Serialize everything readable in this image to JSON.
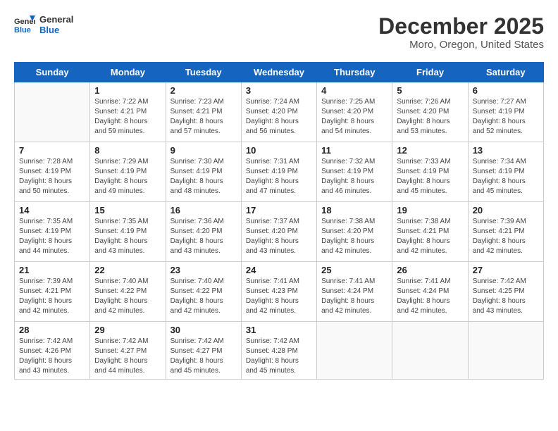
{
  "header": {
    "logo_line1": "General",
    "logo_line2": "Blue",
    "month": "December 2025",
    "location": "Moro, Oregon, United States"
  },
  "weekdays": [
    "Sunday",
    "Monday",
    "Tuesday",
    "Wednesday",
    "Thursday",
    "Friday",
    "Saturday"
  ],
  "weeks": [
    [
      {
        "day": "",
        "info": ""
      },
      {
        "day": "1",
        "info": "Sunrise: 7:22 AM\nSunset: 4:21 PM\nDaylight: 8 hours\nand 59 minutes."
      },
      {
        "day": "2",
        "info": "Sunrise: 7:23 AM\nSunset: 4:21 PM\nDaylight: 8 hours\nand 57 minutes."
      },
      {
        "day": "3",
        "info": "Sunrise: 7:24 AM\nSunset: 4:20 PM\nDaylight: 8 hours\nand 56 minutes."
      },
      {
        "day": "4",
        "info": "Sunrise: 7:25 AM\nSunset: 4:20 PM\nDaylight: 8 hours\nand 54 minutes."
      },
      {
        "day": "5",
        "info": "Sunrise: 7:26 AM\nSunset: 4:20 PM\nDaylight: 8 hours\nand 53 minutes."
      },
      {
        "day": "6",
        "info": "Sunrise: 7:27 AM\nSunset: 4:19 PM\nDaylight: 8 hours\nand 52 minutes."
      }
    ],
    [
      {
        "day": "7",
        "info": "Sunrise: 7:28 AM\nSunset: 4:19 PM\nDaylight: 8 hours\nand 50 minutes."
      },
      {
        "day": "8",
        "info": "Sunrise: 7:29 AM\nSunset: 4:19 PM\nDaylight: 8 hours\nand 49 minutes."
      },
      {
        "day": "9",
        "info": "Sunrise: 7:30 AM\nSunset: 4:19 PM\nDaylight: 8 hours\nand 48 minutes."
      },
      {
        "day": "10",
        "info": "Sunrise: 7:31 AM\nSunset: 4:19 PM\nDaylight: 8 hours\nand 47 minutes."
      },
      {
        "day": "11",
        "info": "Sunrise: 7:32 AM\nSunset: 4:19 PM\nDaylight: 8 hours\nand 46 minutes."
      },
      {
        "day": "12",
        "info": "Sunrise: 7:33 AM\nSunset: 4:19 PM\nDaylight: 8 hours\nand 45 minutes."
      },
      {
        "day": "13",
        "info": "Sunrise: 7:34 AM\nSunset: 4:19 PM\nDaylight: 8 hours\nand 45 minutes."
      }
    ],
    [
      {
        "day": "14",
        "info": "Sunrise: 7:35 AM\nSunset: 4:19 PM\nDaylight: 8 hours\nand 44 minutes."
      },
      {
        "day": "15",
        "info": "Sunrise: 7:35 AM\nSunset: 4:19 PM\nDaylight: 8 hours\nand 43 minutes."
      },
      {
        "day": "16",
        "info": "Sunrise: 7:36 AM\nSunset: 4:20 PM\nDaylight: 8 hours\nand 43 minutes."
      },
      {
        "day": "17",
        "info": "Sunrise: 7:37 AM\nSunset: 4:20 PM\nDaylight: 8 hours\nand 43 minutes."
      },
      {
        "day": "18",
        "info": "Sunrise: 7:38 AM\nSunset: 4:20 PM\nDaylight: 8 hours\nand 42 minutes."
      },
      {
        "day": "19",
        "info": "Sunrise: 7:38 AM\nSunset: 4:21 PM\nDaylight: 8 hours\nand 42 minutes."
      },
      {
        "day": "20",
        "info": "Sunrise: 7:39 AM\nSunset: 4:21 PM\nDaylight: 8 hours\nand 42 minutes."
      }
    ],
    [
      {
        "day": "21",
        "info": "Sunrise: 7:39 AM\nSunset: 4:21 PM\nDaylight: 8 hours\nand 42 minutes."
      },
      {
        "day": "22",
        "info": "Sunrise: 7:40 AM\nSunset: 4:22 PM\nDaylight: 8 hours\nand 42 minutes."
      },
      {
        "day": "23",
        "info": "Sunrise: 7:40 AM\nSunset: 4:22 PM\nDaylight: 8 hours\nand 42 minutes."
      },
      {
        "day": "24",
        "info": "Sunrise: 7:41 AM\nSunset: 4:23 PM\nDaylight: 8 hours\nand 42 minutes."
      },
      {
        "day": "25",
        "info": "Sunrise: 7:41 AM\nSunset: 4:24 PM\nDaylight: 8 hours\nand 42 minutes."
      },
      {
        "day": "26",
        "info": "Sunrise: 7:41 AM\nSunset: 4:24 PM\nDaylight: 8 hours\nand 42 minutes."
      },
      {
        "day": "27",
        "info": "Sunrise: 7:42 AM\nSunset: 4:25 PM\nDaylight: 8 hours\nand 43 minutes."
      }
    ],
    [
      {
        "day": "28",
        "info": "Sunrise: 7:42 AM\nSunset: 4:26 PM\nDaylight: 8 hours\nand 43 minutes."
      },
      {
        "day": "29",
        "info": "Sunrise: 7:42 AM\nSunset: 4:27 PM\nDaylight: 8 hours\nand 44 minutes."
      },
      {
        "day": "30",
        "info": "Sunrise: 7:42 AM\nSunset: 4:27 PM\nDaylight: 8 hours\nand 45 minutes."
      },
      {
        "day": "31",
        "info": "Sunrise: 7:42 AM\nSunset: 4:28 PM\nDaylight: 8 hours\nand 45 minutes."
      },
      {
        "day": "",
        "info": ""
      },
      {
        "day": "",
        "info": ""
      },
      {
        "day": "",
        "info": ""
      }
    ]
  ]
}
